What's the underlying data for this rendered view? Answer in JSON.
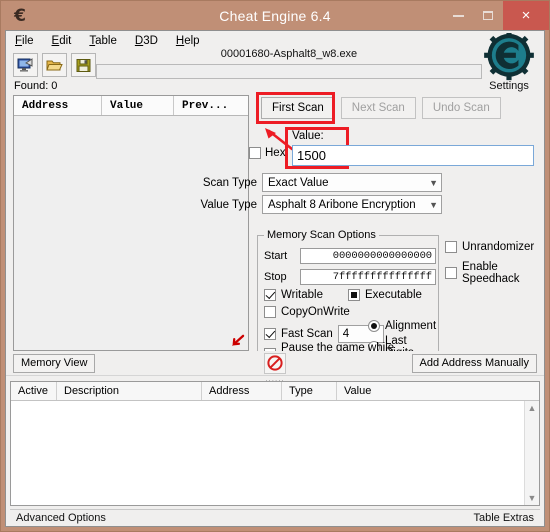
{
  "window": {
    "title": "Cheat Engine 6.4",
    "icon": "cheat-engine-logo-icon",
    "minimize": "–",
    "maximize": "□",
    "close": "×"
  },
  "menubar": [
    {
      "label": "File",
      "accel": "F"
    },
    {
      "label": "Edit",
      "accel": "E"
    },
    {
      "label": "Table",
      "accel": "T"
    },
    {
      "label": "D3D",
      "accel": "D"
    },
    {
      "label": "Help",
      "accel": "H"
    }
  ],
  "toolbar": {
    "buttons": [
      {
        "name": "open-process-button",
        "icon": "monitor-process-icon"
      },
      {
        "name": "open-file-button",
        "icon": "open-folder-icon"
      },
      {
        "name": "save-file-button",
        "icon": "floppy-save-icon"
      }
    ],
    "process_name": "00001680-Asphalt8_w8.exe",
    "progress_value": 0
  },
  "logo": {
    "settings_label": "Settings",
    "brand_text": "Cheat Engine"
  },
  "found": "Found: 0",
  "results": {
    "columns": [
      "Address",
      "Value",
      "Prev..."
    ],
    "rows": []
  },
  "scan": {
    "first_scan": "First Scan",
    "next_scan": "Next Scan",
    "undo_scan": "Undo Scan",
    "next_scan_disabled": true,
    "undo_scan_disabled": true,
    "hex_label": "Hex",
    "hex_checked": false,
    "value_label": "Value:",
    "value": "1500",
    "scan_type_label": "Scan Type",
    "scan_type_value": "Exact Value",
    "value_type_label": "Value Type",
    "value_type_value": "Asphalt 8 Aribone Encryption"
  },
  "memory_options": {
    "title": "Memory Scan Options",
    "start_label": "Start",
    "start_value": "0000000000000000",
    "stop_label": "Stop",
    "stop_value": "7fffffffffffffff",
    "writable_label": "Writable",
    "writable_state": "checked",
    "executable_label": "Executable",
    "executable_state": "indeterminate",
    "copyonwrite_label": "CopyOnWrite",
    "copyonwrite_state": "unchecked",
    "fast_scan_label": "Fast Scan",
    "fast_scan_state": "checked",
    "fast_scan_value": "4",
    "alignment_label": "Alignment",
    "alignment_selected": true,
    "last_digits_label": "Last Digits",
    "last_digits_selected": false,
    "pause_label": "Pause the game while scanning",
    "pause_state": "unchecked"
  },
  "side_options": {
    "unrandomizer_label": "Unrandomizer",
    "unrandomizer_state": "unchecked",
    "speedhack_label": "Enable Speedhack",
    "speedhack_state": "unchecked"
  },
  "mid_bar": {
    "memory_view": "Memory View",
    "stop_icon": "no-entry-stop-icon",
    "add_address": "Add Address Manually"
  },
  "cheat_table": {
    "columns": [
      "Active",
      "Description",
      "Address",
      "Type",
      "Value"
    ],
    "rows": [],
    "scroll_up_icon": "chevron-up-icon",
    "scroll_down_icon": "chevron-down-icon"
  },
  "statusbar": {
    "left": "Advanced Options",
    "right": "Table Extras"
  },
  "annotations": {
    "box_first_scan": "highlight-first-scan",
    "box_value": "highlight-value-field",
    "arrow": "red-arrow-pointing-to-first-scan",
    "color": "#ed1c24"
  },
  "colors": {
    "titlebar": "#c08f76",
    "close_button": "#c9584f",
    "client": "#f0efee",
    "annotation_red": "#ed1c24",
    "logo_teal": "#1f7f8c"
  }
}
